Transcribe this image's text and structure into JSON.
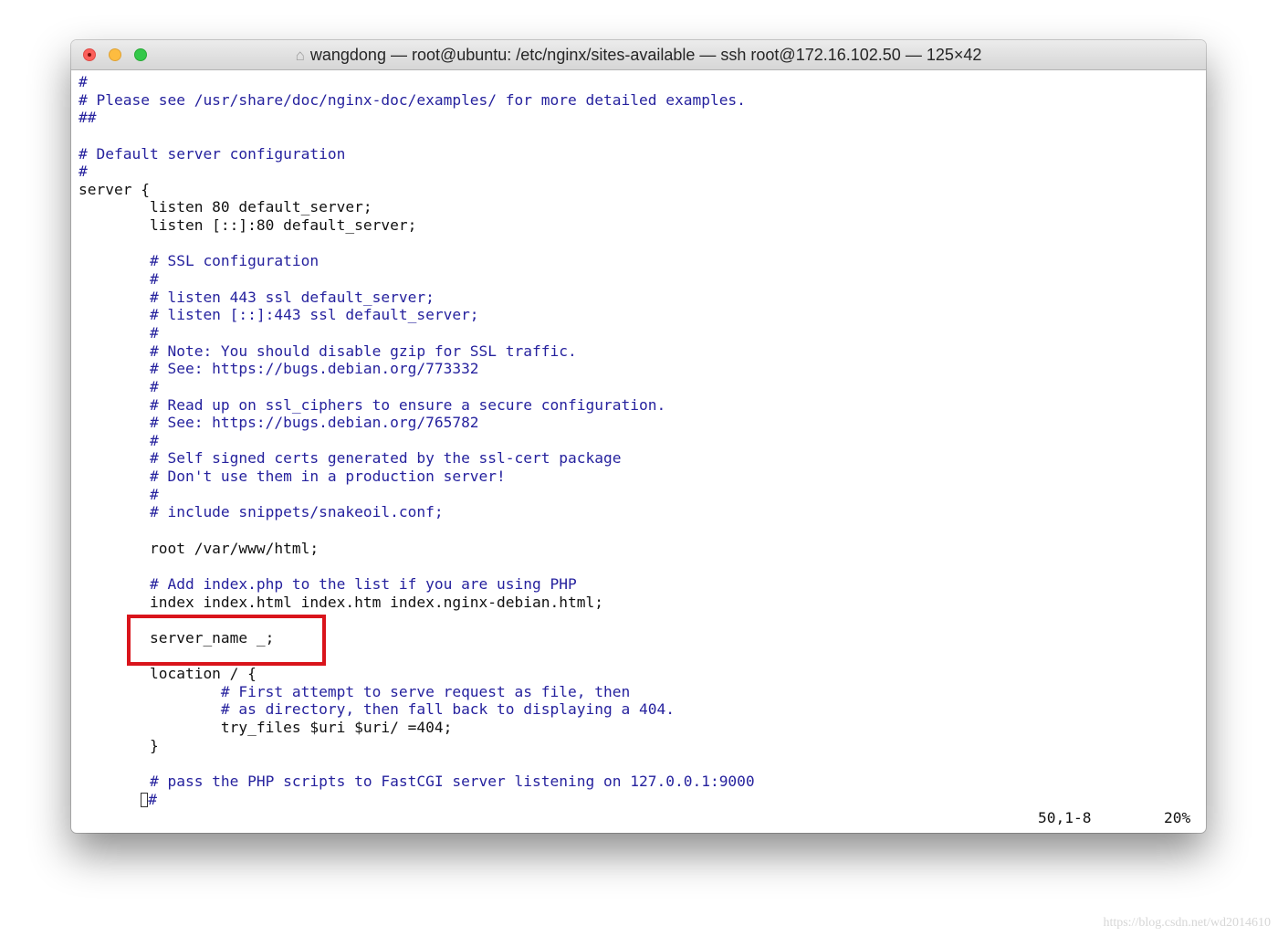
{
  "window": {
    "title": "wangdong — root@ubuntu: /etc/nginx/sites-available — ssh root@172.16.102.50 — 125×42",
    "title_icon": "home-icon"
  },
  "colors": {
    "comment": "#26229e",
    "code": "#111111",
    "highlight_box": "#d9141b"
  },
  "lines": [
    {
      "text": "#",
      "type": "comment"
    },
    {
      "text": "# Please see /usr/share/doc/nginx-doc/examples/ for more detailed examples.",
      "type": "comment"
    },
    {
      "text": "##",
      "type": "comment"
    },
    {
      "text": "",
      "type": "code"
    },
    {
      "text": "# Default server configuration",
      "type": "comment"
    },
    {
      "text": "#",
      "type": "comment"
    },
    {
      "text": "server {",
      "type": "code"
    },
    {
      "text": "        listen 80 default_server;",
      "type": "code"
    },
    {
      "text": "        listen [::]:80 default_server;",
      "type": "code"
    },
    {
      "text": "",
      "type": "code"
    },
    {
      "text": "        # SSL configuration",
      "type": "comment"
    },
    {
      "text": "        #",
      "type": "comment"
    },
    {
      "text": "        # listen 443 ssl default_server;",
      "type": "comment"
    },
    {
      "text": "        # listen [::]:443 ssl default_server;",
      "type": "comment"
    },
    {
      "text": "        #",
      "type": "comment"
    },
    {
      "text": "        # Note: You should disable gzip for SSL traffic.",
      "type": "comment"
    },
    {
      "text": "        # See: https://bugs.debian.org/773332",
      "type": "comment"
    },
    {
      "text": "        #",
      "type": "comment"
    },
    {
      "text": "        # Read up on ssl_ciphers to ensure a secure configuration.",
      "type": "comment"
    },
    {
      "text": "        # See: https://bugs.debian.org/765782",
      "type": "comment"
    },
    {
      "text": "        #",
      "type": "comment"
    },
    {
      "text": "        # Self signed certs generated by the ssl-cert package",
      "type": "comment"
    },
    {
      "text": "        # Don't use them in a production server!",
      "type": "comment"
    },
    {
      "text": "        #",
      "type": "comment"
    },
    {
      "text": "        # include snippets/snakeoil.conf;",
      "type": "comment"
    },
    {
      "text": "",
      "type": "code"
    },
    {
      "text": "        root /var/www/html;",
      "type": "code"
    },
    {
      "text": "",
      "type": "code"
    },
    {
      "text": "        # Add index.php to the list if you are using PHP",
      "type": "comment"
    },
    {
      "text": "        index index.html index.htm index.nginx-debian.html;",
      "type": "code"
    },
    {
      "text": "",
      "type": "code"
    },
    {
      "text": "        server_name _;",
      "type": "code"
    },
    {
      "text": "",
      "type": "code"
    },
    {
      "text": "        location / {",
      "type": "code"
    },
    {
      "text": "                # First attempt to serve request as file, then",
      "type": "comment"
    },
    {
      "text": "                # as directory, then fall back to displaying a 404.",
      "type": "comment"
    },
    {
      "text": "                try_files $uri $uri/ =404;",
      "type": "code"
    },
    {
      "text": "        }",
      "type": "code"
    },
    {
      "text": "",
      "type": "code"
    },
    {
      "text": "        # pass the PHP scripts to FastCGI server listening on 127.0.0.1:9000",
      "type": "comment"
    },
    {
      "text": "#",
      "type": "comment",
      "cursor_before": true
    }
  ],
  "status": {
    "position": "50,1-8",
    "percent": "20%"
  },
  "watermark": "https://blog.csdn.net/wd2014610"
}
